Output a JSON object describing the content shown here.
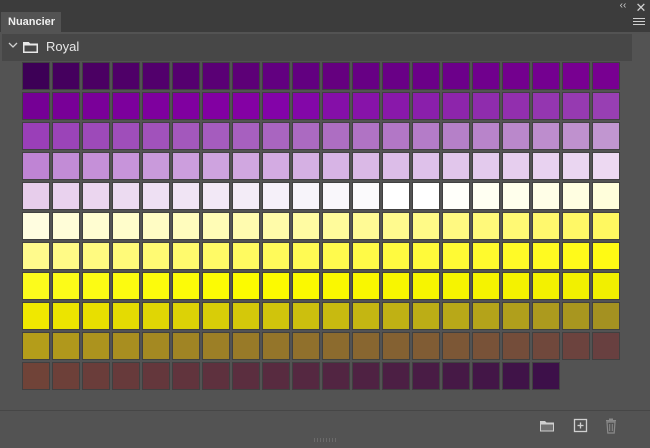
{
  "panel": {
    "title": "Nuancier"
  },
  "controls": {
    "collapse_glyph": "‹‹",
    "close_glyph": "✕"
  },
  "group": {
    "label": "Royal",
    "expanded": true,
    "icon": "folder-icon"
  },
  "footer": {
    "buttons": [
      "new-group-folder-icon",
      "new-swatch-icon",
      "delete-swatch-icon"
    ]
  },
  "swatches": [
    [
      "#3d0056",
      "#45005e",
      "#4b0063",
      "#4f0068",
      "#52006c",
      "#55006f",
      "#5a0075",
      "#5d0077",
      "#620080",
      "#620080",
      "#65007f",
      "#670084",
      "#690086",
      "#6b0088",
      "#6c008a",
      "#70008d",
      "#73008e",
      "#740090",
      "#780091",
      "#780091"
    ],
    [
      "#750095",
      "#780097",
      "#7a0099",
      "#7c009c",
      "#7e009e",
      "#8000a0",
      "#8200a2",
      "#8401a4",
      "#8303a8",
      "#8307a8",
      "#850fa8",
      "#8713a9",
      "#8918aa",
      "#8a1fab",
      "#8d25ab",
      "#8f2cad",
      "#922fae",
      "#9436b0",
      "#963ab1",
      "#983fb3"
    ],
    [
      "#9a3fb8",
      "#9b44b8",
      "#9d4ab9",
      "#9f4eba",
      "#a152bb",
      "#a358bc",
      "#a55cbe",
      "#a760bf",
      "#a965c0",
      "#ab6ac1",
      "#ad6ec2",
      "#b073c4",
      "#b277c6",
      "#b47cc8",
      "#b580c8",
      "#b884ca",
      "#ba88cb",
      "#bd8dcd",
      "#bf91ce",
      "#c196d0"
    ],
    [
      "#bf84d4",
      "#c28cd6",
      "#c590d8",
      "#c794da",
      "#c99adb",
      "#cc9edd",
      "#cea3df",
      "#d0a7e0",
      "#d3abe2",
      "#d5b0e3",
      "#d7b4e5",
      "#dab9e6",
      "#dcbde8",
      "#dec1ea",
      "#e1c6eb",
      "#e3caed",
      "#e6ceee",
      "#e8d2f0",
      "#ead6f1",
      "#edd9f2"
    ],
    [
      "#e7cdeb",
      "#e9d2ee",
      "#ebd6ef",
      "#ecdbf1",
      "#eee0f3",
      "#f0e4f4",
      "#f2e8f6",
      "#f3ecf7",
      "#f5f0f9",
      "#f7f4fa",
      "#f9f7fb",
      "#fbfafc",
      "#ffffff",
      "#ffffff",
      "#fffffa",
      "#fffff2",
      "#ffffec",
      "#fffee7",
      "#fffee1",
      "#fffedb"
    ],
    [
      "#fffde0",
      "#fffdd8",
      "#fffdd1",
      "#fffdcb",
      "#fffcc4",
      "#fffcbd",
      "#fffcb6",
      "#fffbaf",
      "#fffba9",
      "#fffba2",
      "#fffb9b",
      "#fffa95",
      "#fffa8e",
      "#fffa87",
      "#fff981",
      "#fff97a",
      "#fff974",
      "#fff86d",
      "#fff866",
      "#fff860"
    ],
    [
      "#fffa8c",
      "#fffa86",
      "#fffa80",
      "#fffa79",
      "#fffa73",
      "#fffa6d",
      "#fffa66",
      "#fffa60",
      "#fffa5a",
      "#fffa53",
      "#fffa4d",
      "#fffa47",
      "#fffa40",
      "#fffa3a",
      "#fffa34",
      "#fffa2d",
      "#fffa27",
      "#fffa21",
      "#fffa1a",
      "#fffa14"
    ],
    [
      "#fcfb1c",
      "#fcfb18",
      "#fcfb14",
      "#fcfb10",
      "#fcfb0c",
      "#fcfb08",
      "#fcfb04",
      "#fcfb00",
      "#fcfa00",
      "#fbf900",
      "#faf800",
      "#f9f700",
      "#f8f600",
      "#f7f500",
      "#f6f400",
      "#f5f300",
      "#f4f200",
      "#f3f100",
      "#f2f000",
      "#f1ef00"
    ],
    [
      "#f0e800",
      "#ece400",
      "#e8df00",
      "#e4db02",
      "#e0d604",
      "#dcd206",
      "#d8cd08",
      "#d4c80a",
      "#d0c40c",
      "#ccbf0e",
      "#c8ba10",
      "#c4b612",
      "#c0b114",
      "#bcad16",
      "#b8a818",
      "#b4a31a",
      "#b09f1c",
      "#ac9a1e",
      "#a8961f",
      "#a49121"
    ],
    [
      "#b49d1a",
      "#b0981c",
      "#ac931e",
      "#a88e20",
      "#a48922",
      "#a08424",
      "#9c7f26",
      "#987a28",
      "#94752a",
      "#90702c",
      "#8c6b2e",
      "#886630",
      "#846132",
      "#805c34",
      "#7c5736",
      "#785238",
      "#744d3a",
      "#70483c",
      "#6c433e",
      "#684040"
    ],
    [
      "#704338",
      "#6d4039",
      "#6a3d3a",
      "#673a3b",
      "#64373c",
      "#61343d",
      "#5e313e",
      "#5b2e3f",
      "#582b40",
      "#552841",
      "#522542",
      "#4f2243",
      "#4c1f44",
      "#491c45",
      "#461946",
      "#431647",
      "#401348",
      "#3d1049"
    ]
  ]
}
